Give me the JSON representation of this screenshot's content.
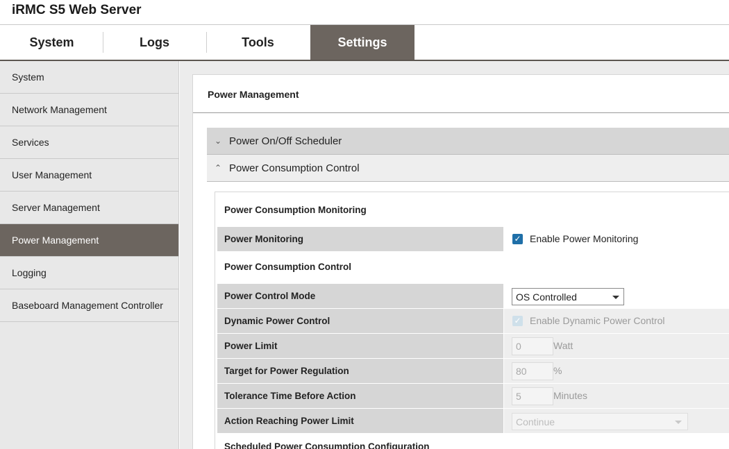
{
  "app": {
    "title": "iRMC S5 Web Server"
  },
  "tabs": [
    {
      "label": "System",
      "active": false
    },
    {
      "label": "Logs",
      "active": false
    },
    {
      "label": "Tools",
      "active": false
    },
    {
      "label": "Settings",
      "active": true
    }
  ],
  "sidebar": {
    "items": [
      {
        "label": "System"
      },
      {
        "label": "Network Management"
      },
      {
        "label": "Services"
      },
      {
        "label": "User Management"
      },
      {
        "label": "Server Management"
      },
      {
        "label": "Power Management",
        "active": true
      },
      {
        "label": "Logging"
      },
      {
        "label": "Baseboard Management Controller"
      }
    ]
  },
  "panel": {
    "title": "Power Management",
    "sections": {
      "scheduler": {
        "label": "Power On/Off Scheduler",
        "expanded": false,
        "icon": "chevron-down-icon"
      },
      "control": {
        "label": "Power Consumption Control",
        "expanded": true,
        "icon": "chevron-up-icon"
      }
    },
    "monitoring_heading": "Power Consumption Monitoring",
    "power_monitoring": {
      "label": "Power Monitoring",
      "checkbox_label": "Enable Power Monitoring",
      "checked": true
    },
    "control_heading": "Power Consumption Control",
    "power_control_mode": {
      "label": "Power Control Mode",
      "value": "OS Controlled"
    },
    "dynamic_power_control": {
      "label": "Dynamic Power Control",
      "checkbox_label": "Enable Dynamic Power Control",
      "checked": true,
      "disabled": true
    },
    "power_limit": {
      "label": "Power Limit",
      "value": "0",
      "unit": "Watt"
    },
    "target_regulation": {
      "label": "Target for Power Regulation",
      "value": "80",
      "unit": "%"
    },
    "tolerance_time": {
      "label": "Tolerance Time Before Action",
      "value": "5",
      "unit": "Minutes"
    },
    "action_limit": {
      "label": "Action Reaching Power Limit",
      "value": "Continue"
    },
    "scheduled_heading": "Scheduled Power Consumption Configuration"
  },
  "colors": {
    "accent": "#6c655f",
    "checkbox": "#1f6fa8"
  }
}
